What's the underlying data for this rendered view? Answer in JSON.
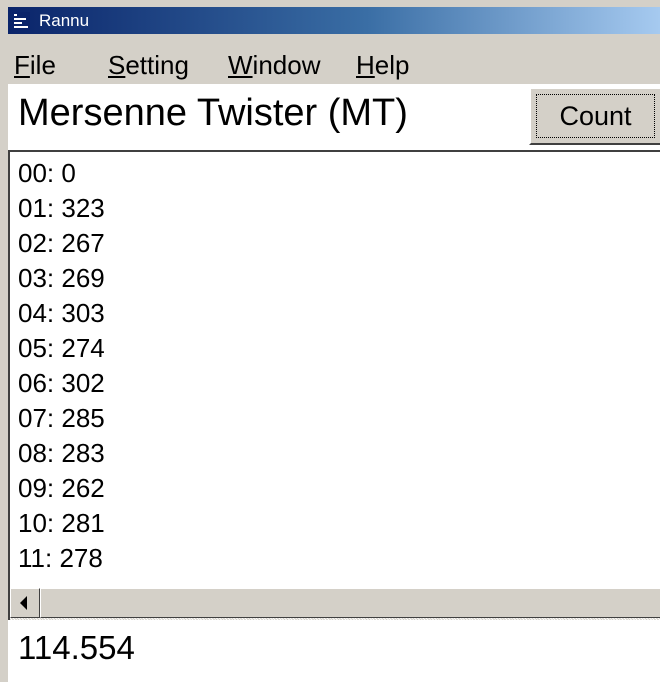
{
  "window": {
    "title": "Rannu"
  },
  "menu": {
    "items": [
      {
        "prefix": "",
        "accel": "F",
        "rest": "ile"
      },
      {
        "prefix": "",
        "accel": "S",
        "rest": "etting"
      },
      {
        "prefix": "",
        "accel": "W",
        "rest": "indow"
      },
      {
        "prefix": "",
        "accel": "H",
        "rest": "elp"
      }
    ]
  },
  "header": {
    "generator_name": "Mersenne Twister (MT)",
    "count_label": "Count"
  },
  "list": {
    "items": [
      "00: 0",
      "01: 323",
      "02: 267",
      "03: 269",
      "04: 303",
      "05: 274",
      "06: 302",
      "07: 285",
      "08: 283",
      "09: 262",
      "10: 281",
      "11: 278"
    ]
  },
  "status": {
    "value": "114.554"
  },
  "icons": {
    "app": "app-list-icon",
    "scroll_left": "arrow-left-icon"
  }
}
